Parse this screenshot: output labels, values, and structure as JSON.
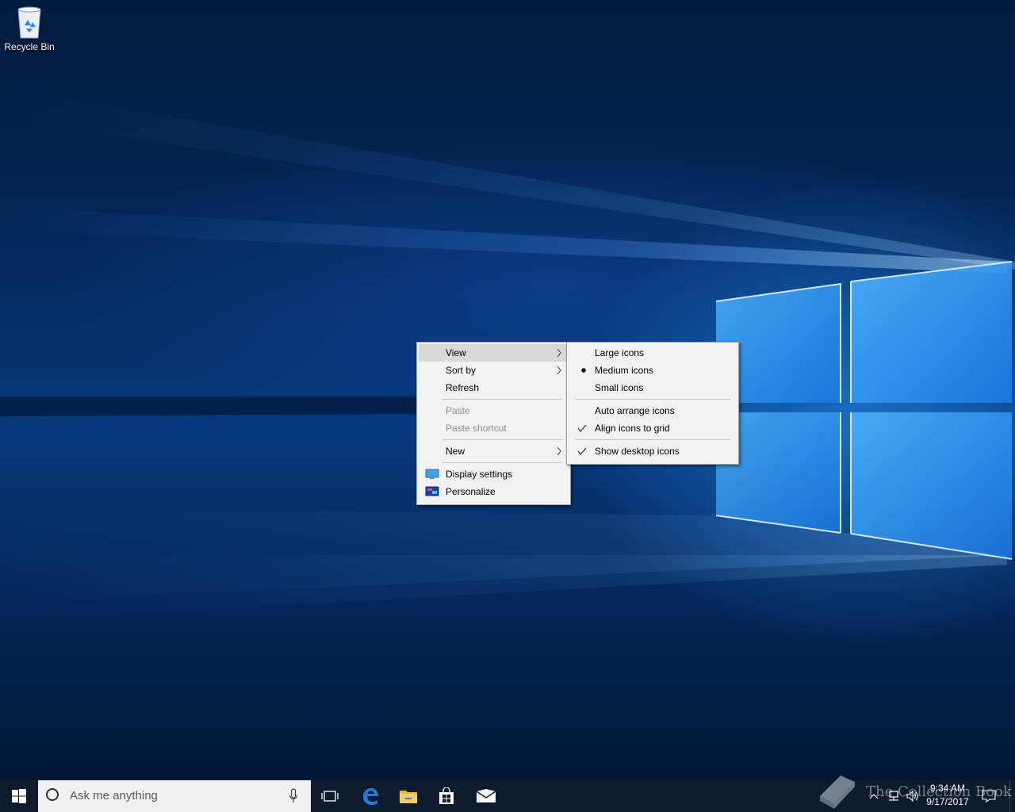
{
  "desktop": {
    "icons": [
      {
        "label": "Recycle Bin"
      }
    ]
  },
  "context_menu": {
    "items": [
      {
        "label": "View",
        "submenu": true,
        "highlighted": true
      },
      {
        "label": "Sort by",
        "submenu": true
      },
      {
        "label": "Refresh"
      },
      {
        "label": "Paste",
        "disabled": true
      },
      {
        "label": "Paste shortcut",
        "disabled": true
      },
      {
        "label": "New",
        "submenu": true
      },
      {
        "label": "Display settings",
        "icon": "display-icon"
      },
      {
        "label": "Personalize",
        "icon": "personalize-icon"
      }
    ]
  },
  "view_submenu": {
    "items": [
      {
        "label": "Large icons"
      },
      {
        "label": "Medium icons",
        "mark": "bullet"
      },
      {
        "label": "Small icons"
      },
      {
        "label": "Auto arrange icons"
      },
      {
        "label": "Align icons to grid",
        "mark": "check"
      },
      {
        "label": "Show desktop icons",
        "mark": "check"
      }
    ]
  },
  "taskbar": {
    "search_placeholder": "Ask me anything",
    "pinned": [
      "task-view-icon",
      "edge-icon",
      "file-explorer-icon",
      "store-icon",
      "mail-icon"
    ],
    "clock": {
      "time": "9:34 AM",
      "date": "9/17/2017"
    }
  },
  "watermark": {
    "text": "The Collection Book"
  },
  "colors": {
    "taskbar": "#0e1a2e",
    "menu_bg": "#f2f2f2",
    "menu_highlight": "#d9d9d9",
    "disabled_text": "#8d8d8d"
  }
}
